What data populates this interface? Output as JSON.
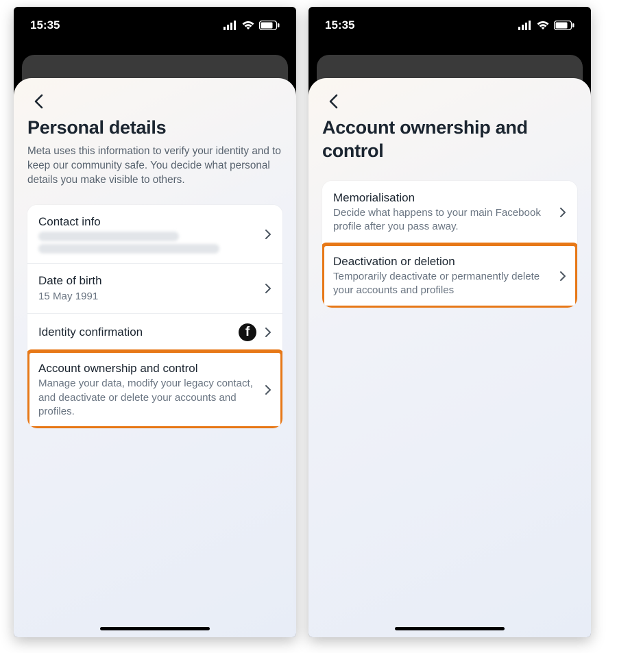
{
  "status": {
    "time": "15:35"
  },
  "left": {
    "title": "Personal details",
    "subtitle": "Meta uses this information to verify your identity and to keep our community safe. You decide what personal details you make visible to others.",
    "rows": {
      "contact": {
        "title": "Contact info"
      },
      "dob": {
        "title": "Date of birth",
        "sub": "15 May 1991"
      },
      "identity": {
        "title": "Identity confirmation"
      },
      "ownership": {
        "title": "Account ownership and control",
        "sub": "Manage your data, modify your legacy contact, and deactivate or delete your accounts and profiles."
      }
    }
  },
  "right": {
    "title": "Account ownership and control",
    "rows": {
      "memorial": {
        "title": "Memorialisation",
        "sub": "Decide what happens to your main Facebook profile after you pass away."
      },
      "deactivate": {
        "title": "Deactivation or deletion",
        "sub": "Temporarily deactivate or permanently delete your accounts and profiles"
      }
    }
  }
}
